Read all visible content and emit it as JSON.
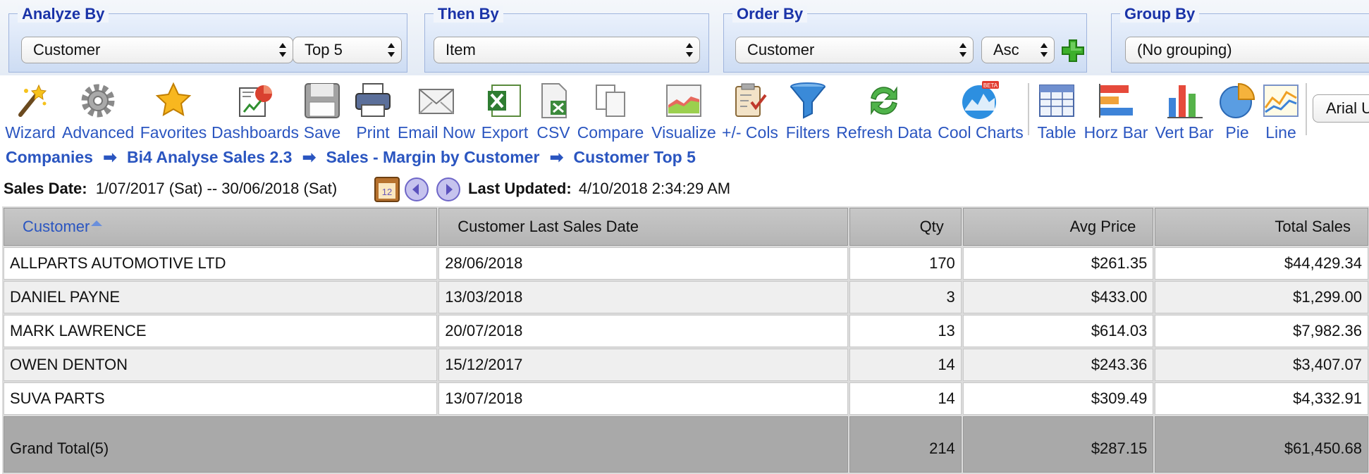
{
  "filters": {
    "analyze_by": {
      "legend": "Analyze By",
      "field": "Customer",
      "top": "Top 5"
    },
    "then_by": {
      "legend": "Then By",
      "field": "Item"
    },
    "order_by": {
      "legend": "Order By",
      "field": "Customer",
      "direction": "Asc"
    },
    "group_by": {
      "legend": "Group By",
      "field": "(No grouping)"
    }
  },
  "toolbar": {
    "wizard": "Wizard",
    "advanced": "Advanced",
    "favorites": "Favorites",
    "dashboards": "Dashboards",
    "save": "Save",
    "print": "Print",
    "email_now": "Email Now",
    "export": "Export",
    "csv": "CSV",
    "compare": "Compare",
    "visualize": "Visualize",
    "cols": "+/- Cols",
    "filters": "Filters",
    "refresh": "Refresh Data",
    "cool_charts": "Cool Charts",
    "cool_badge": "BETA",
    "table": "Table",
    "horz_bar": "Horz Bar",
    "vert_bar": "Vert Bar",
    "pie": "Pie",
    "line": "Line",
    "font": "Arial U"
  },
  "breadcrumb": {
    "c1": "Companies",
    "c2": "Bi4 Analyse Sales 2.3",
    "c3": "Sales - Margin by Customer",
    "c4": "Customer Top 5",
    "arrow": "➡"
  },
  "dates": {
    "label": "Sales Date:",
    "range": "1/07/2017 (Sat) -- 30/06/2018 (Sat)",
    "calendar_day": "12",
    "updated_label": "Last Updated:",
    "updated_value": "4/10/2018 2:34:29 AM"
  },
  "table": {
    "headers": {
      "customer": "Customer",
      "last_date": "Customer Last Sales Date",
      "qty": "Qty",
      "avg_price": "Avg Price",
      "total_sales": "Total Sales"
    },
    "rows": [
      {
        "customer": "ALLPARTS AUTOMOTIVE LTD",
        "last_date": "28/06/2018",
        "qty": "170",
        "avg_price": "$261.35",
        "total_sales": "$44,429.34"
      },
      {
        "customer": "DANIEL PAYNE",
        "last_date": "13/03/2018",
        "qty": "3",
        "avg_price": "$433.00",
        "total_sales": "$1,299.00"
      },
      {
        "customer": "MARK LAWRENCE",
        "last_date": "20/07/2018",
        "qty": "13",
        "avg_price": "$614.03",
        "total_sales": "$7,982.36"
      },
      {
        "customer": "OWEN DENTON",
        "last_date": "15/12/2017",
        "qty": "14",
        "avg_price": "$243.36",
        "total_sales": "$3,407.07"
      },
      {
        "customer": "SUVA PARTS",
        "last_date": "13/07/2018",
        "qty": "14",
        "avg_price": "$309.49",
        "total_sales": "$4,332.91"
      }
    ],
    "total": {
      "label": "Grand Total(5)",
      "qty": "214",
      "avg_price": "$287.15",
      "total_sales": "$61,450.68"
    }
  }
}
